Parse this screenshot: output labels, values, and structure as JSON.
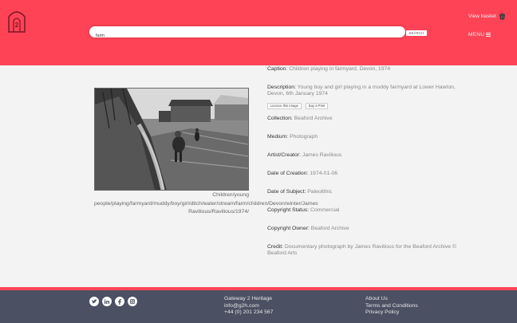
{
  "header": {
    "search_value": "farm",
    "search_button_label": "SEARCH",
    "basket_label": "View basket",
    "menu_label": "MENU"
  },
  "image": {
    "tags": "Children/young people/playing/farmyard/muddy/boy/girl/ditch/water/stream/farm/children/Devon/winter/James Ravilious/Ravilious/1974/"
  },
  "details": {
    "caption": {
      "label": "Caption:",
      "value": "Children playing in farmyard, Devon, 1974"
    },
    "description": {
      "label": "Description:",
      "value": "Young boy and girl playing in a muddy farmyard at Lower Hawton, Devon, 6th January 1974"
    },
    "licence_button": "Licence this Image",
    "print_button": "Buy a Print",
    "collection": {
      "label": "Collection:",
      "value": "Beaford Archive"
    },
    "medium": {
      "label": "Medium:",
      "value": "Photograph"
    },
    "artist": {
      "label": "Artist/Creator:",
      "value": "James Ravilious"
    },
    "date_creation": {
      "label": "Date of Creation:",
      "value": "1974-01-06"
    },
    "date_subject": {
      "label": "Date of Subject:",
      "value": "Paleolithic"
    },
    "copyright_status": {
      "label": "Copyright Status:",
      "value": "Commercial"
    },
    "copyright_owner": {
      "label": "Copyright Owner:",
      "value": "Beaford Archive"
    },
    "credit": {
      "label": "Credit:",
      "value": "Documentary photograph by James Ravilious for the Beaford Archive © Beaford Arts"
    }
  },
  "footer": {
    "org_name": "Gateway 2 Heritage",
    "email": "info@g2h.com",
    "phone": "+44 (0) 201 234 567",
    "links": [
      "About Us",
      "Terms and Conditions",
      "Privacy Policy"
    ],
    "social_icons": [
      "twitter-icon",
      "linkedin-icon",
      "facebook-icon",
      "instagram-icon"
    ]
  },
  "colors": {
    "brand": "#ff4357",
    "footer_bg": "#4b5063",
    "page_bg": "#f3f3f3"
  }
}
